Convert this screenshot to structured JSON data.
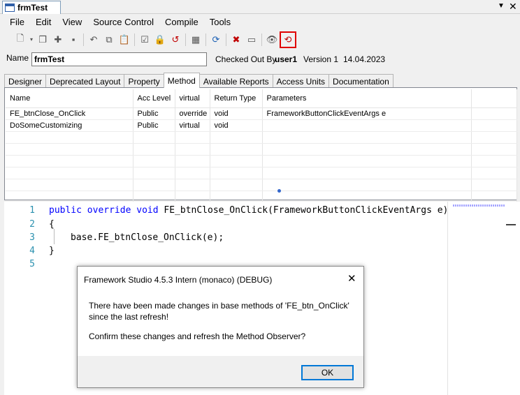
{
  "window": {
    "doc_tab": "frmTest"
  },
  "menu": [
    "File",
    "Edit",
    "View",
    "Source Control",
    "Compile",
    "Tools"
  ],
  "header": {
    "name_label": "Name",
    "name_value": "frmTest",
    "checked_out_label": "Checked Out By",
    "checked_out_user": "user1",
    "version": "Version 1",
    "date": "14.04.2023"
  },
  "tabs": [
    "Designer",
    "Deprecated Layout",
    "Property",
    "Method",
    "Available Reports",
    "Access Units",
    "Documentation"
  ],
  "active_tab": "Method",
  "methods_table": {
    "columns": [
      "Name",
      "Acc Level",
      "virtual",
      "Return Type",
      "Parameters"
    ],
    "rows": [
      [
        "FE_btnClose_OnClick",
        "Public",
        "override",
        "void",
        "FrameworkButtonClickEventArgs e"
      ],
      [
        "DoSomeCustomizing",
        "Public",
        "virtual",
        "void",
        ""
      ]
    ]
  },
  "editor": {
    "line_numbers": [
      "1",
      "2",
      "3",
      "4",
      "5"
    ],
    "line1": {
      "kw1": "public",
      "kw2": "override",
      "kw3": "void",
      "rest": " FE_btnClose_OnClick(FrameworkButtonClickEventArgs e)"
    },
    "line2": "{",
    "line3": "base.FE_btnClose_OnClick(e);",
    "line4": "}"
  },
  "dialog": {
    "title": "Framework Studio 4.5.3 Intern (monaco) (DEBUG)",
    "close": "✕",
    "message1": "There have been made changes in base methods of 'FE_btn_OnClick' since the last refresh!",
    "message2": "Confirm these changes and refresh the Method Observer?",
    "ok_label": "OK"
  }
}
